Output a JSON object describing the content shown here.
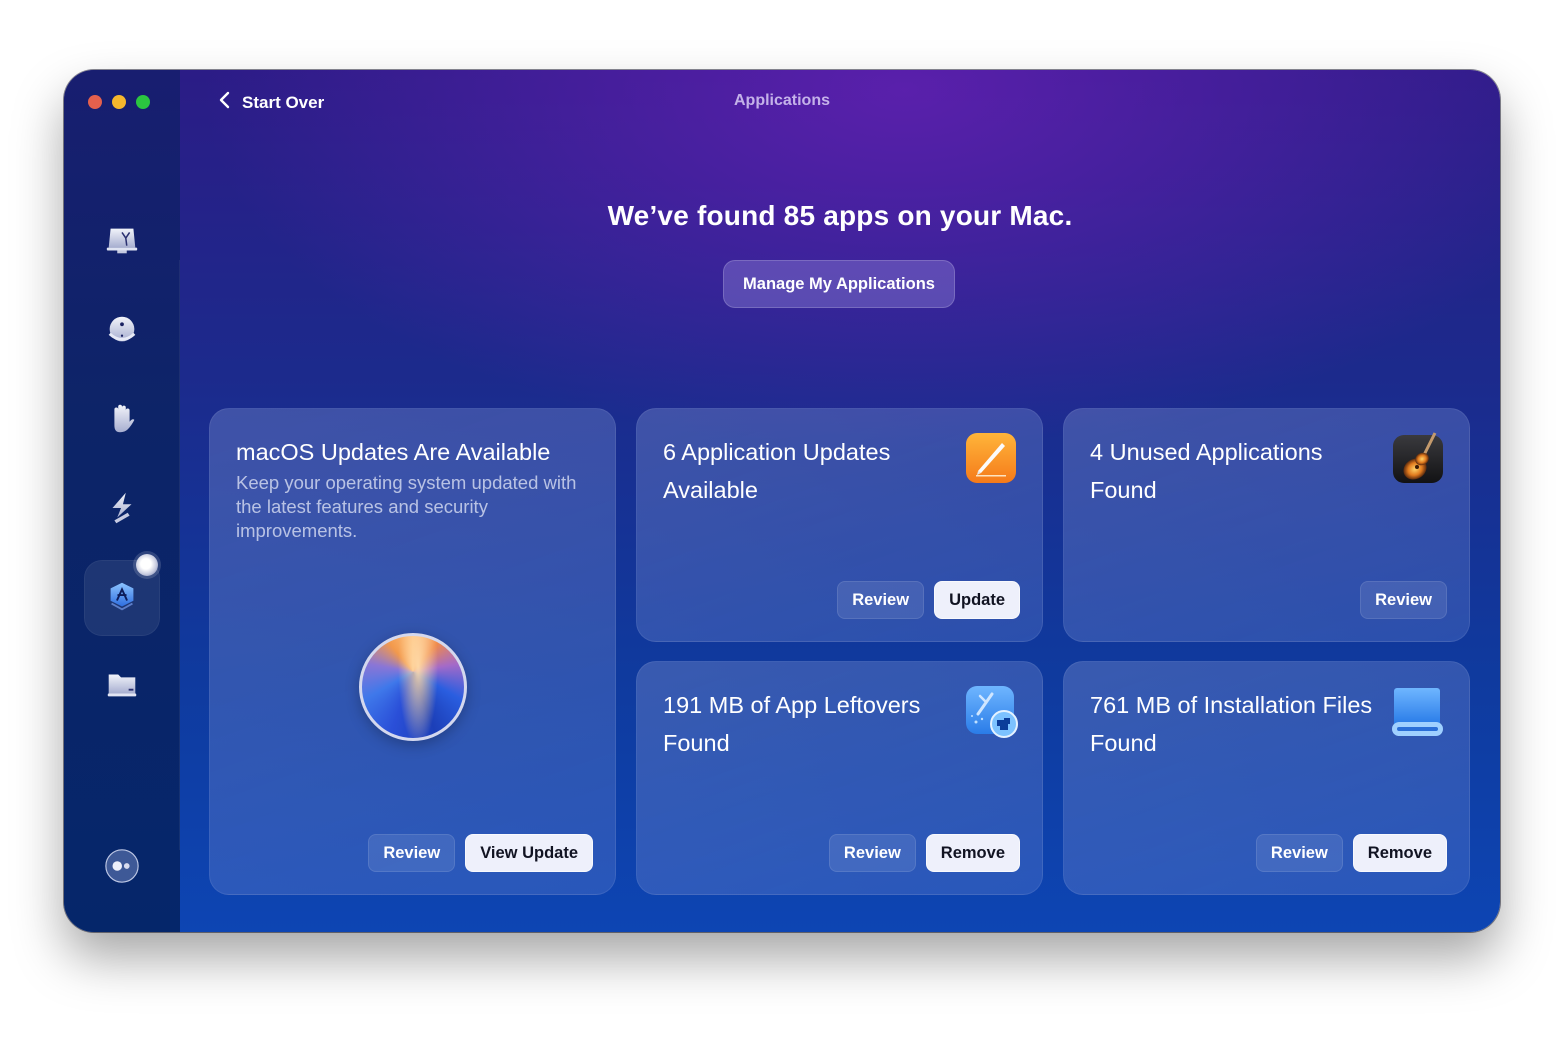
{
  "window": {
    "title": "Applications",
    "back_label": "Start Over"
  },
  "traffic_lights": {
    "close": "#e5604d",
    "minimize": "#f6b72d",
    "maximize": "#2bc640"
  },
  "sidebar": {
    "items": [
      {
        "name": "smart-care",
        "icon": "imac-broom-icon",
        "active": false
      },
      {
        "name": "cleanup",
        "icon": "bubble-ball-icon",
        "active": false
      },
      {
        "name": "protection",
        "icon": "hand-icon",
        "active": false
      },
      {
        "name": "performance",
        "icon": "lightning-icon",
        "active": false
      },
      {
        "name": "applications",
        "icon": "app-store-hexagon-icon",
        "active": true
      },
      {
        "name": "my-clutter",
        "icon": "folder-drive-icon",
        "active": false
      }
    ],
    "assistant_icon": "assistant-bubble-icon"
  },
  "main": {
    "headline": "We’ve found 85 apps on your Mac.",
    "manage_button": "Manage My Applications"
  },
  "cards": [
    {
      "id": "macos-updates",
      "title": "macOS Updates Are Available",
      "description": "Keep your operating system updated with the latest features and security improvements.",
      "icon": "macos-sequoia-icon",
      "buttons": [
        {
          "label": "Review",
          "style": "secondary"
        },
        {
          "label": "View Update",
          "style": "primary"
        }
      ]
    },
    {
      "id": "app-updates",
      "title": "6 Application Updates Available",
      "icon": "pages-app-icon",
      "buttons": [
        {
          "label": "Review",
          "style": "secondary"
        },
        {
          "label": "Update",
          "style": "primary"
        }
      ]
    },
    {
      "id": "unused-apps",
      "title": "4 Unused Applications Found",
      "icon": "garageband-guitar-icon",
      "buttons": [
        {
          "label": "Review",
          "style": "secondary"
        }
      ]
    },
    {
      "id": "app-leftovers",
      "title": "191 MB of App Leftovers Found",
      "icon": "leftovers-broom-puzzle-icon",
      "buttons": [
        {
          "label": "Review",
          "style": "secondary"
        },
        {
          "label": "Remove",
          "style": "primary"
        }
      ]
    },
    {
      "id": "installation-files",
      "title": "761 MB of Installation Files Found",
      "icon": "install-drive-icon",
      "buttons": [
        {
          "label": "Review",
          "style": "secondary"
        },
        {
          "label": "Remove",
          "style": "primary"
        }
      ]
    }
  ]
}
